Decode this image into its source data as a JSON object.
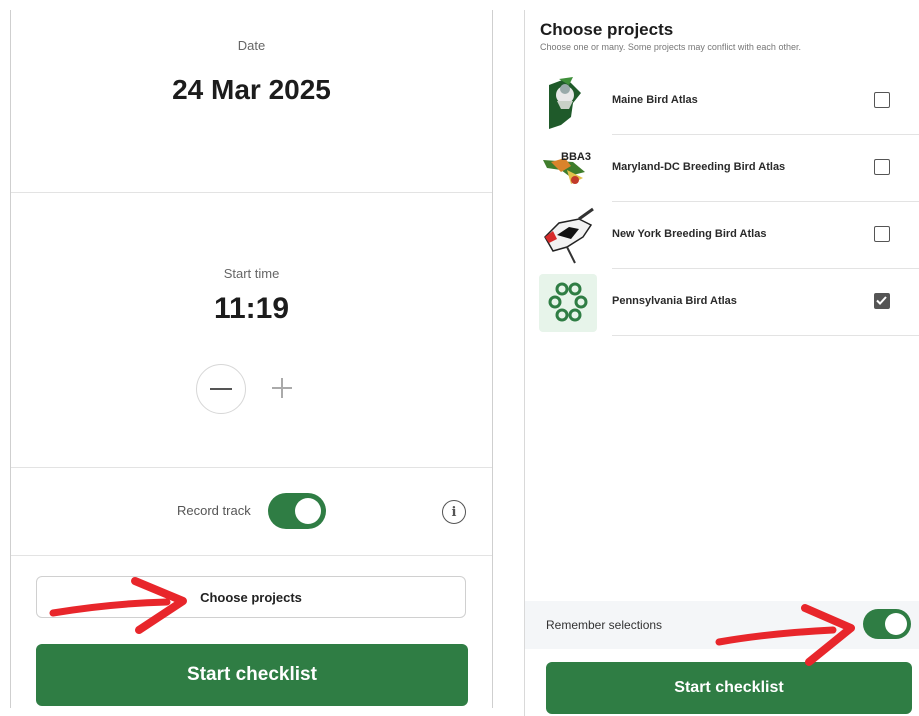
{
  "left_panel": {
    "date_label": "Date",
    "date_value": "24 Mar 2025",
    "start_time_label": "Start time",
    "start_time_value": "11:19",
    "record_track_label": "Record track",
    "record_track_on": true,
    "choose_projects_label": "Choose projects",
    "start_checklist_label": "Start checklist"
  },
  "right_panel": {
    "title": "Choose projects",
    "subtitle": "Choose one or many. Some projects may conflict with each other.",
    "projects": [
      {
        "name": "Maine Bird Atlas",
        "checked": false,
        "logo": "maine-atlas-logo"
      },
      {
        "name": "Maryland-DC Breeding Bird Atlas",
        "checked": false,
        "logo": "mddc-atlas-logo",
        "logo_text": "BBA3"
      },
      {
        "name": "New York Breeding Bird Atlas",
        "checked": false,
        "logo": "ny-atlas-logo"
      },
      {
        "name": "Pennsylvania Bird Atlas",
        "checked": true,
        "logo": "pa-atlas-logo"
      }
    ],
    "remember_label": "Remember selections",
    "remember_on": true,
    "start_checklist_label": "Start checklist"
  },
  "colors": {
    "accent": "#2f7d44",
    "annotation_arrow": "#e8262b"
  },
  "icons": [
    "minus-icon",
    "plus-icon",
    "info-icon",
    "checkmark-icon",
    "arrow-annotation"
  ]
}
